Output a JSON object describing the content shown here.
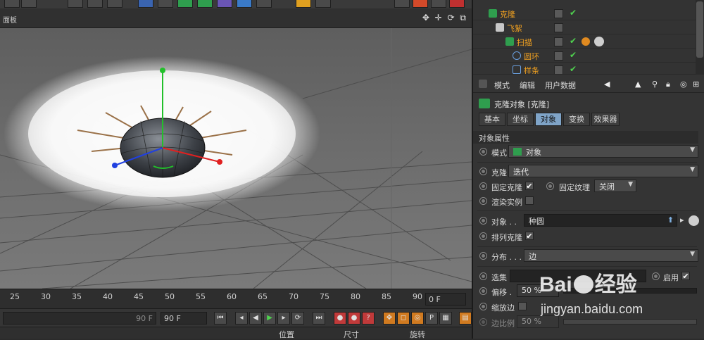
{
  "viewport": {
    "panel_label": "面板",
    "nav_icons": "✥ ✛ ⟳ ⧉"
  },
  "timeline": {
    "ticks": [
      "25",
      "30",
      "35",
      "40",
      "45",
      "50",
      "55",
      "60",
      "65",
      "70",
      "75",
      "80",
      "85",
      "90"
    ],
    "current_frame": "0 F"
  },
  "playbar": {
    "end_field": "90 F",
    "max_field": "90 F"
  },
  "coords": {
    "position": "位置",
    "size": "尺寸",
    "rotation": "旋转"
  },
  "object_manager": {
    "items": [
      {
        "name": "克隆",
        "indent": 1
      },
      {
        "name": "飞絮",
        "indent": 2
      },
      {
        "name": "扫描",
        "indent": 3
      },
      {
        "name": "圆环",
        "indent": 4
      },
      {
        "name": "样条",
        "indent": 4
      }
    ]
  },
  "attributes": {
    "menu": [
      "模式",
      "编辑",
      "用户数据"
    ],
    "object_title": "克隆对象 [克隆]",
    "tabs": [
      "基本",
      "坐标",
      "对象",
      "变换",
      "效果器"
    ],
    "active_tab": "对象",
    "section_title": "对象属性",
    "mode": {
      "label": "模式",
      "value": "对象"
    },
    "clones": {
      "label": "克隆",
      "value": "迭代"
    },
    "fix_clone": {
      "label": "固定克隆",
      "checked": "✔"
    },
    "fix_texture": {
      "label": "固定纹理",
      "value": "关闭"
    },
    "render_instances": {
      "label": "渲染实例"
    },
    "object": {
      "label": "对象 . .",
      "value": "种圆"
    },
    "arrange_clones": {
      "label": "排列克隆",
      "checked": "✔"
    },
    "distribution": {
      "label": "分布 . . .",
      "value": "边"
    },
    "selection": {
      "label": "选集",
      "enable_label": "启用",
      "enable_checked": "✔"
    },
    "offset": {
      "label": "偏移 .",
      "value": "50 %"
    },
    "scale_edge": {
      "label": "缩放边"
    },
    "edge_ratio": {
      "label": "边比例",
      "value": "50 %"
    }
  },
  "watermark": {
    "brand": "Bai",
    "brand2": "经验",
    "url": "jingyan.baidu.com"
  },
  "colors": {
    "accent": "#7fa4c8",
    "highlight_name": "#f0a020",
    "check": "#4fd24f"
  }
}
